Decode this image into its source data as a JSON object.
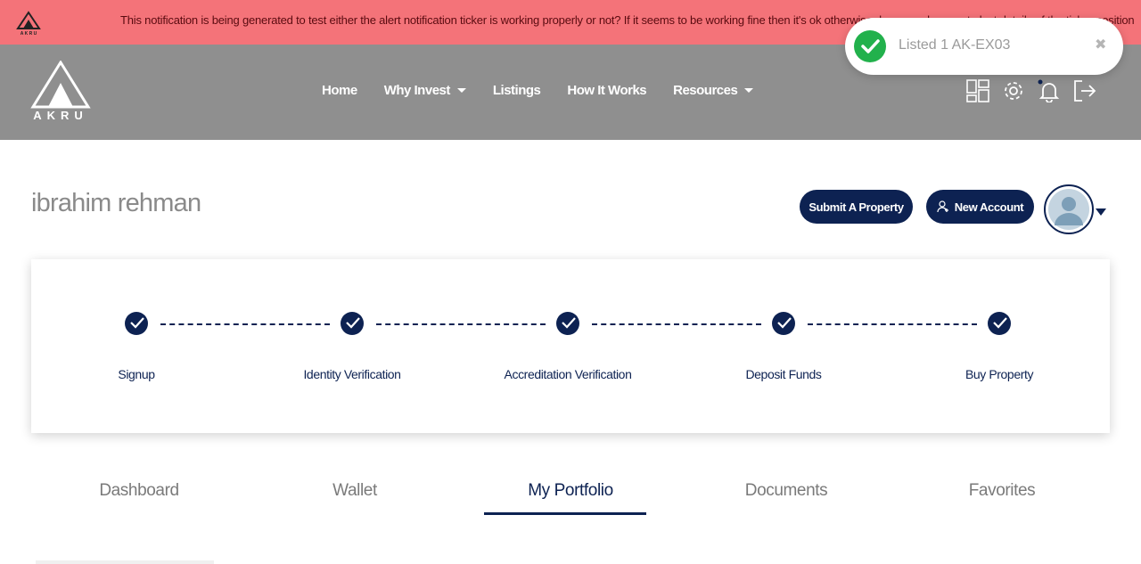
{
  "ticker": {
    "text": "This notification is being generated to test either the alert notification ticker is working properly or not? If it seems to be working fine then it's ok otherwise do some changes to lost details of the ticker position"
  },
  "brand": {
    "name": "AKRU"
  },
  "nav": {
    "links": [
      {
        "label": "Home",
        "has_dropdown": false
      },
      {
        "label": "Why Invest",
        "has_dropdown": true
      },
      {
        "label": "Listings",
        "has_dropdown": false
      },
      {
        "label": "How It Works",
        "has_dropdown": false
      },
      {
        "label": "Resources",
        "has_dropdown": true
      }
    ],
    "icons": [
      "dashboard-grid-icon",
      "gear-icon",
      "bell-icon",
      "logout-icon"
    ]
  },
  "toast": {
    "message": "Listed 1 AK-EX03",
    "close": "✖"
  },
  "profile": {
    "name": "ibrahim rehman",
    "submit_label": "Submit A Property",
    "new_account_label": "New Account"
  },
  "progress": {
    "steps": [
      {
        "label": "Signup",
        "done": true
      },
      {
        "label": "Identity Verification",
        "done": true
      },
      {
        "label": "Accreditation Verification",
        "done": true
      },
      {
        "label": "Deposit Funds",
        "done": true
      },
      {
        "label": "Buy Property",
        "done": true
      }
    ]
  },
  "tabs": [
    {
      "label": "Dashboard",
      "active": false
    },
    {
      "label": "Wallet",
      "active": false
    },
    {
      "label": "My Portfolio",
      "active": true
    },
    {
      "label": "Documents",
      "active": false
    },
    {
      "label": "Favorites",
      "active": false
    }
  ],
  "colors": {
    "ticker_bg": "#f47379",
    "navbar_bg": "#8f8f8f",
    "primary": "#0d2252",
    "success": "#22b14c"
  }
}
